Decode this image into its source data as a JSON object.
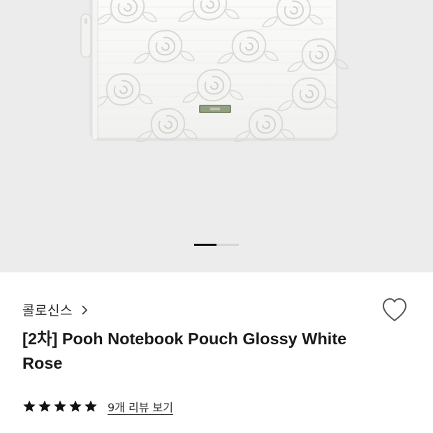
{
  "gallery": {
    "image_alt": "white rose embossed notebook pouch",
    "slide_count": 2,
    "active_slide": 1
  },
  "product": {
    "brand": "콜로신스",
    "title": "[2차] Pooh Notebook Pouch Glossy White Rose",
    "rating_stars": 5,
    "review_link": "9개 리뷰 보기"
  },
  "icons": {
    "brand_arrow": "chevron-right-icon",
    "wishlist": "heart-outline-icon",
    "star": "star-icon"
  },
  "colors": {
    "gallery_background": "#ececec",
    "pouch": "#f7f7f5",
    "text": "#1a1a1a",
    "star": "#111111",
    "pager_active": "#111111",
    "pager_inactive": "#d6d6d6"
  }
}
